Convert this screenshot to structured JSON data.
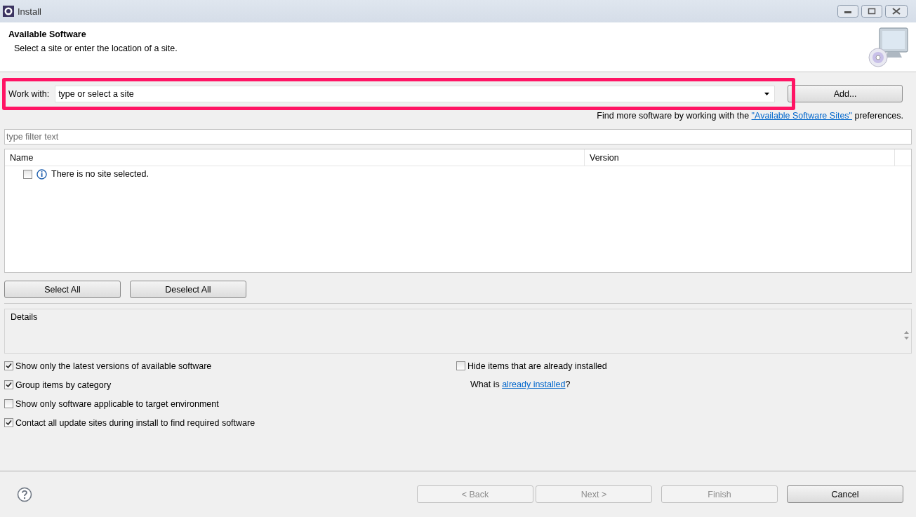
{
  "window": {
    "title": "Install"
  },
  "header": {
    "title": "Available Software",
    "description": "Select a site or enter the location of a site."
  },
  "work_with": {
    "label": "Work with:",
    "placeholder": "type or select a site",
    "highlighted": true
  },
  "add_button": "Add...",
  "find_more": {
    "before": "Find more software by working with the ",
    "link": "\"Available Software Sites\"",
    "after": " preferences."
  },
  "filter": {
    "placeholder": "type filter text"
  },
  "table": {
    "columns": [
      "Name",
      "Version"
    ],
    "rows": [
      {
        "checked": false,
        "text": "There is no site selected."
      }
    ]
  },
  "select_buttons": [
    "Select All",
    "Deselect All"
  ],
  "details": {
    "label": "Details"
  },
  "options_left": [
    {
      "label": "Show only the latest versions of available software",
      "checked": true
    },
    {
      "label": "Group items by category",
      "checked": true
    },
    {
      "label": "Show only software applicable to target environment",
      "checked": false
    },
    {
      "label": "Contact all update sites during install to find required software",
      "checked": true
    }
  ],
  "options_right": [
    {
      "kind": "checkbox",
      "label": "Hide items that are already installed",
      "checked": false
    },
    {
      "kind": "link_text",
      "before": "What is ",
      "link": "already installed",
      "after": "?"
    }
  ],
  "footer_buttons": [
    {
      "label": "< Back",
      "disabled": true
    },
    {
      "label": "Next >",
      "disabled": true
    },
    {
      "label": "Finish",
      "disabled": true
    },
    {
      "label": "Cancel",
      "disabled": false
    }
  ]
}
